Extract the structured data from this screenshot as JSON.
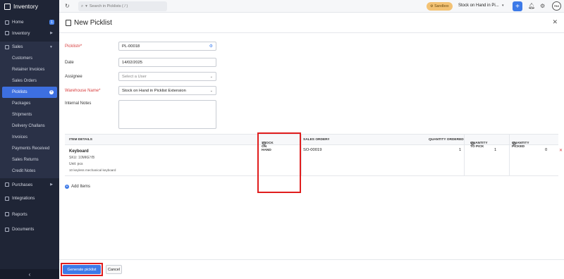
{
  "app": {
    "name": "Inventory"
  },
  "sidebar": {
    "home": {
      "label": "Home",
      "badge": "1"
    },
    "inventory": {
      "label": "Inventory"
    },
    "sales": {
      "label": "Sales"
    },
    "sales_items": [
      {
        "label": "Customers"
      },
      {
        "label": "Retainer Invoices"
      },
      {
        "label": "Sales Orders"
      },
      {
        "label": "Picklists"
      },
      {
        "label": "Packages"
      },
      {
        "label": "Shipments"
      },
      {
        "label": "Delivery Challans"
      },
      {
        "label": "Invoices"
      },
      {
        "label": "Payments Received"
      },
      {
        "label": "Sales Returns"
      },
      {
        "label": "Credit Notes"
      }
    ],
    "purchases": {
      "label": "Purchases"
    },
    "integrations": {
      "label": "Integrations"
    },
    "reports": {
      "label": "Reports"
    },
    "documents": {
      "label": "Documents"
    }
  },
  "topbar": {
    "search_placeholder": "Search in Picklists ( / )",
    "sandbox_label": "⚙ Sandbox",
    "org_name": "Stock on Hand in Pi...",
    "avatar_text": "PBM"
  },
  "page": {
    "title": "New Picklist",
    "fields": {
      "picklist": {
        "label": "Picklist#*",
        "value": "PL-00018"
      },
      "date": {
        "label": "Date",
        "value": "14/02/2025"
      },
      "assignee": {
        "label": "Assignee",
        "placeholder": "Select a User"
      },
      "warehouse": {
        "label": "Warehouse Name*",
        "value": "Stock on Hand in Picklist Extension"
      },
      "notes": {
        "label": "Internal Notes"
      }
    },
    "table": {
      "headers": {
        "item_details": "ITEM DETAILS",
        "stock_on_hand": "STOCK ON HAND",
        "sales_order": "SALES ORDER#",
        "qty_ordered": "QUANTITY ORDERED",
        "qty_to_pick": "QUANTITY TO PICK",
        "qty_picked": "QUANTITY PICKED"
      },
      "rows": [
        {
          "item_name": "Keyboard",
          "sku": "SKU: 10MKEYB",
          "unit": "Unit: pcs",
          "description": "10 keyless mechanical keyboard",
          "stock_on_hand": "",
          "sales_order": "SO-00019",
          "qty_ordered": "1",
          "qty_to_pick": "1",
          "qty_picked": "0"
        }
      ]
    },
    "add_items_label": "Add Items",
    "buttons": {
      "generate": "Generate picklist",
      "cancel": "Cancel"
    }
  },
  "colors": {
    "sidebar_bg": "#1f2536",
    "accent": "#3d7ae8",
    "highlight": "#e01d1d",
    "required": "#d84040"
  }
}
